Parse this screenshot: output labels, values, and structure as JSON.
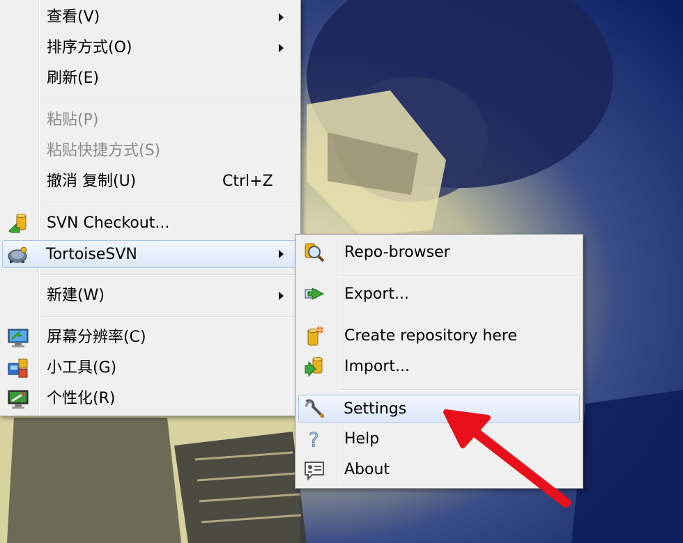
{
  "desktop": {
    "accent_dark": "#12266a",
    "accent_light": "#efe7b6"
  },
  "context_menu": {
    "items": [
      {
        "label": "查看(V)",
        "submenu": true,
        "enabled": true
      },
      {
        "label": "排序方式(O)",
        "submenu": true,
        "enabled": true
      },
      {
        "label": "刷新(E)",
        "submenu": false,
        "enabled": true
      },
      {
        "label": "粘贴(P)",
        "submenu": false,
        "enabled": false
      },
      {
        "label": "粘贴快捷方式(S)",
        "submenu": false,
        "enabled": false
      },
      {
        "label": "撤消 复制(U)",
        "shortcut": "Ctrl+Z",
        "submenu": false,
        "enabled": true
      },
      {
        "label": "SVN Checkout...",
        "icon": "svn-checkout-icon",
        "submenu": false,
        "enabled": true
      },
      {
        "label": "TortoiseSVN",
        "icon": "tortoisesvn-icon",
        "submenu": true,
        "enabled": true,
        "highlighted": true
      },
      {
        "label": "新建(W)",
        "submenu": true,
        "enabled": true
      },
      {
        "label": "屏幕分辨率(C)",
        "icon": "screen-resolution-icon",
        "submenu": false,
        "enabled": true
      },
      {
        "label": "小工具(G)",
        "icon": "gadgets-icon",
        "submenu": false,
        "enabled": true
      },
      {
        "label": "个性化(R)",
        "icon": "personalize-icon",
        "submenu": false,
        "enabled": true
      }
    ]
  },
  "svn_submenu": {
    "items": [
      {
        "label": "Repo-browser",
        "icon": "repo-browser-icon"
      },
      {
        "label": "Export...",
        "icon": "export-icon"
      },
      {
        "label": "Create repository here",
        "icon": "create-repository-icon"
      },
      {
        "label": "Import...",
        "icon": "import-icon"
      },
      {
        "label": "Settings",
        "icon": "settings-icon",
        "highlighted": true
      },
      {
        "label": "Help",
        "icon": "help-icon"
      },
      {
        "label": "About",
        "icon": "about-icon"
      }
    ]
  },
  "annotation": {
    "arrow_color": "#e8101a"
  }
}
